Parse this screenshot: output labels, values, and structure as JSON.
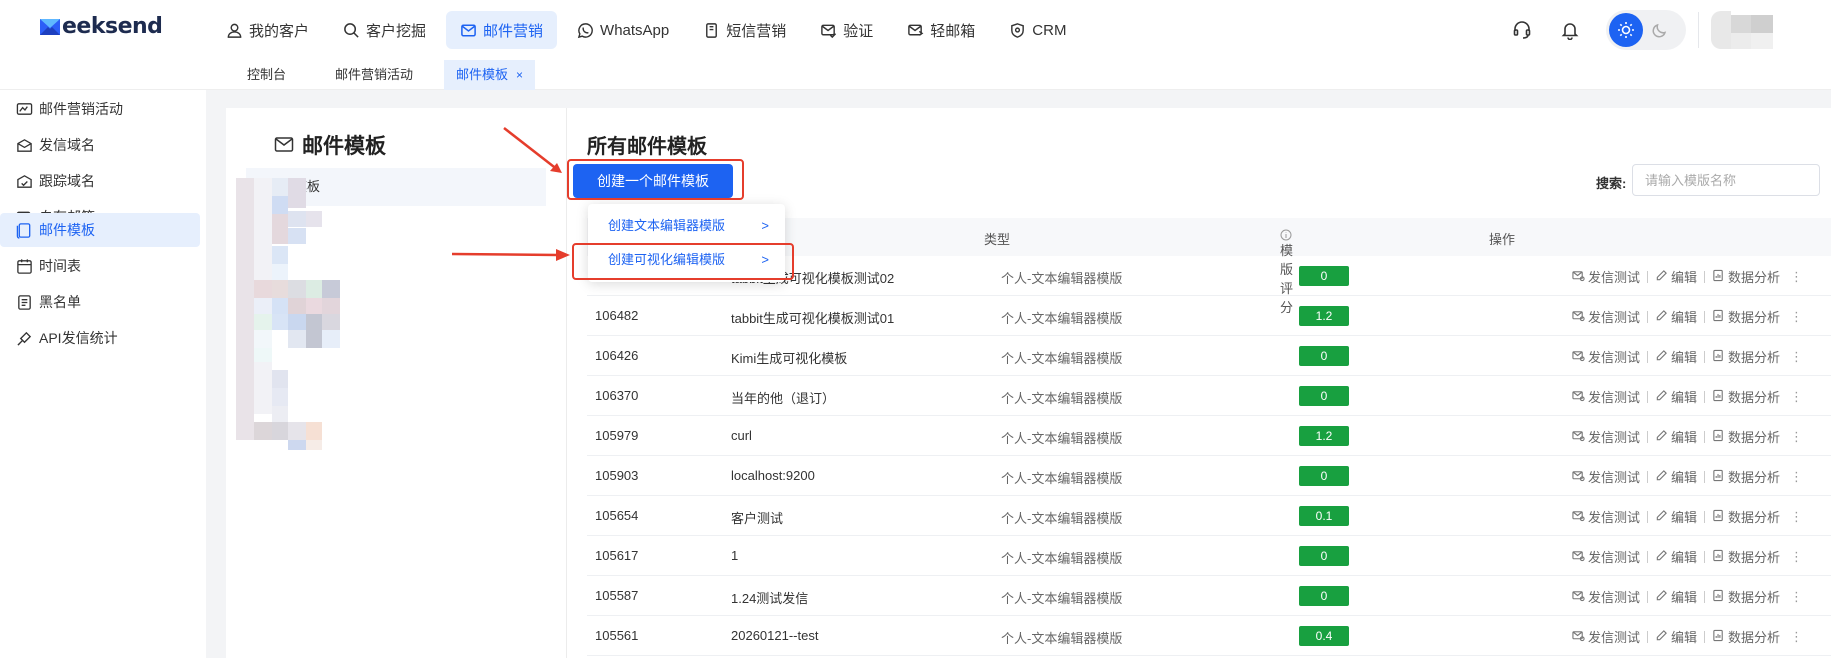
{
  "logo": {
    "text": "eeksend"
  },
  "nav": [
    {
      "label": "我的客户",
      "icon": "user-icon",
      "active": false
    },
    {
      "label": "客户挖掘",
      "icon": "search-icon",
      "active": false
    },
    {
      "label": "邮件营销",
      "icon": "mail-icon",
      "active": true
    },
    {
      "label": "WhatsApp",
      "icon": "whatsapp-icon",
      "active": false
    },
    {
      "label": "短信营销",
      "icon": "sms-icon",
      "active": false
    },
    {
      "label": "验证",
      "icon": "verify-icon",
      "active": false
    },
    {
      "label": "轻邮箱",
      "icon": "light-mailbox-icon",
      "active": false
    },
    {
      "label": "CRM",
      "icon": "crm-icon",
      "active": false
    }
  ],
  "tabs": [
    {
      "label": "控制台",
      "active": false
    },
    {
      "label": "邮件营销活动",
      "active": false
    },
    {
      "label": "邮件模板",
      "active": true,
      "close": "×"
    }
  ],
  "sidebar": [
    {
      "label": "邮件营销活动",
      "icon": "campaign-icon",
      "active": false
    },
    {
      "label": "发信域名",
      "icon": "sending-domain-icon",
      "active": false
    },
    {
      "label": "跟踪域名",
      "icon": "tracking-domain-icon",
      "active": false
    },
    {
      "label": "自有邮箱",
      "icon": "own-mailbox-icon",
      "active": false
    },
    {
      "label": "邮件模板",
      "icon": "template-icon",
      "active": true
    },
    {
      "label": "时间表",
      "icon": "schedule-icon",
      "active": false
    },
    {
      "label": "黑名单",
      "icon": "blacklist-icon",
      "active": false
    },
    {
      "label": "API发信统计",
      "icon": "api-stats-icon",
      "active": false
    }
  ],
  "left_panel": {
    "title": "邮件模板",
    "all_label": "所有模板"
  },
  "right_panel": {
    "title": "所有邮件模板",
    "create_button": "创建一个邮件模板",
    "search_label": "搜索:",
    "search_placeholder": "请输入模版名称",
    "columns": {
      "type": "类型",
      "score": "模版评分",
      "actions": "操作"
    },
    "actions": {
      "test": "发信测试",
      "edit": "编辑",
      "analysis": "数据分析",
      "more": "⋮"
    },
    "rows": [
      {
        "id": "",
        "name": "tabbit生成可视化模板测试02",
        "type": "个人-文本编辑器模版",
        "score": "0"
      },
      {
        "id": "106482",
        "name": "tabbit生成可视化模板测试01",
        "type": "个人-文本编辑器模版",
        "score": "1.2"
      },
      {
        "id": "106426",
        "name": "Kimi生成可视化模板",
        "type": "个人-文本编辑器模版",
        "score": "0"
      },
      {
        "id": "106370",
        "name": "当年的他（退订）",
        "type": "个人-文本编辑器模版",
        "score": "0"
      },
      {
        "id": "105979",
        "name": "curl",
        "type": "个人-文本编辑器模版",
        "score": "1.2"
      },
      {
        "id": "105903",
        "name": "localhost:9200",
        "type": "个人-文本编辑器模版",
        "score": "0"
      },
      {
        "id": "105654",
        "name": "客户测试",
        "type": "个人-文本编辑器模版",
        "score": "0.1"
      },
      {
        "id": "105617",
        "name": "1",
        "type": "个人-文本编辑器模版",
        "score": "0"
      },
      {
        "id": "105587",
        "name": "1.24测试发信",
        "type": "个人-文本编辑器模版",
        "score": "0"
      },
      {
        "id": "105561",
        "name": "20260121--test",
        "type": "个人-文本编辑器模版",
        "score": "0.4"
      }
    ]
  },
  "dropdown": [
    {
      "label": "创建文本编辑器模版",
      "chevron": ">"
    },
    {
      "label": "创建可视化编辑模版",
      "chevron": ">"
    }
  ],
  "colors": {
    "primary": "#1d63f2",
    "active_bg": "#e6effd",
    "badge": "#18a040",
    "annotation": "#e53d2c"
  }
}
